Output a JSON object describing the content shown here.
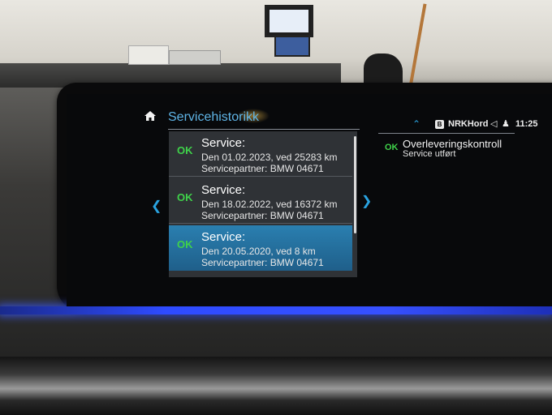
{
  "header": {
    "title": "Servicehistorikk"
  },
  "services": [
    {
      "status": "OK",
      "title": "Service:",
      "line1": "Den 01.02.2023, ved 25283 km",
      "line2": "Servicepartner: BMW 04671",
      "selected": false
    },
    {
      "status": "OK",
      "title": "Service:",
      "line1": "Den 18.02.2022, ved 16372 km",
      "line2": "Servicepartner: BMW 04671",
      "selected": false
    },
    {
      "status": "OK",
      "title": "Service:",
      "line1": "Den 20.05.2020, ved 8 km",
      "line2": "Servicepartner: BMW 04671",
      "selected": true
    }
  ],
  "status_bar": {
    "radio_band": "B",
    "radio_station": "NRKHord",
    "time": "11:25"
  },
  "detail": {
    "status": "OK",
    "title": "Overleveringskontroll",
    "subtitle": "Service utført"
  },
  "icons": {
    "home": "home-icon",
    "left": "chevron-left-icon",
    "right": "chevron-right-icon",
    "up": "chevron-up-icon",
    "speaker": "speaker-icon",
    "user": "user-icon"
  },
  "colors": {
    "accent": "#5fb4e6",
    "ok": "#3fd24a",
    "selected": "#2a7fb0",
    "ambient": "#3650ff"
  }
}
